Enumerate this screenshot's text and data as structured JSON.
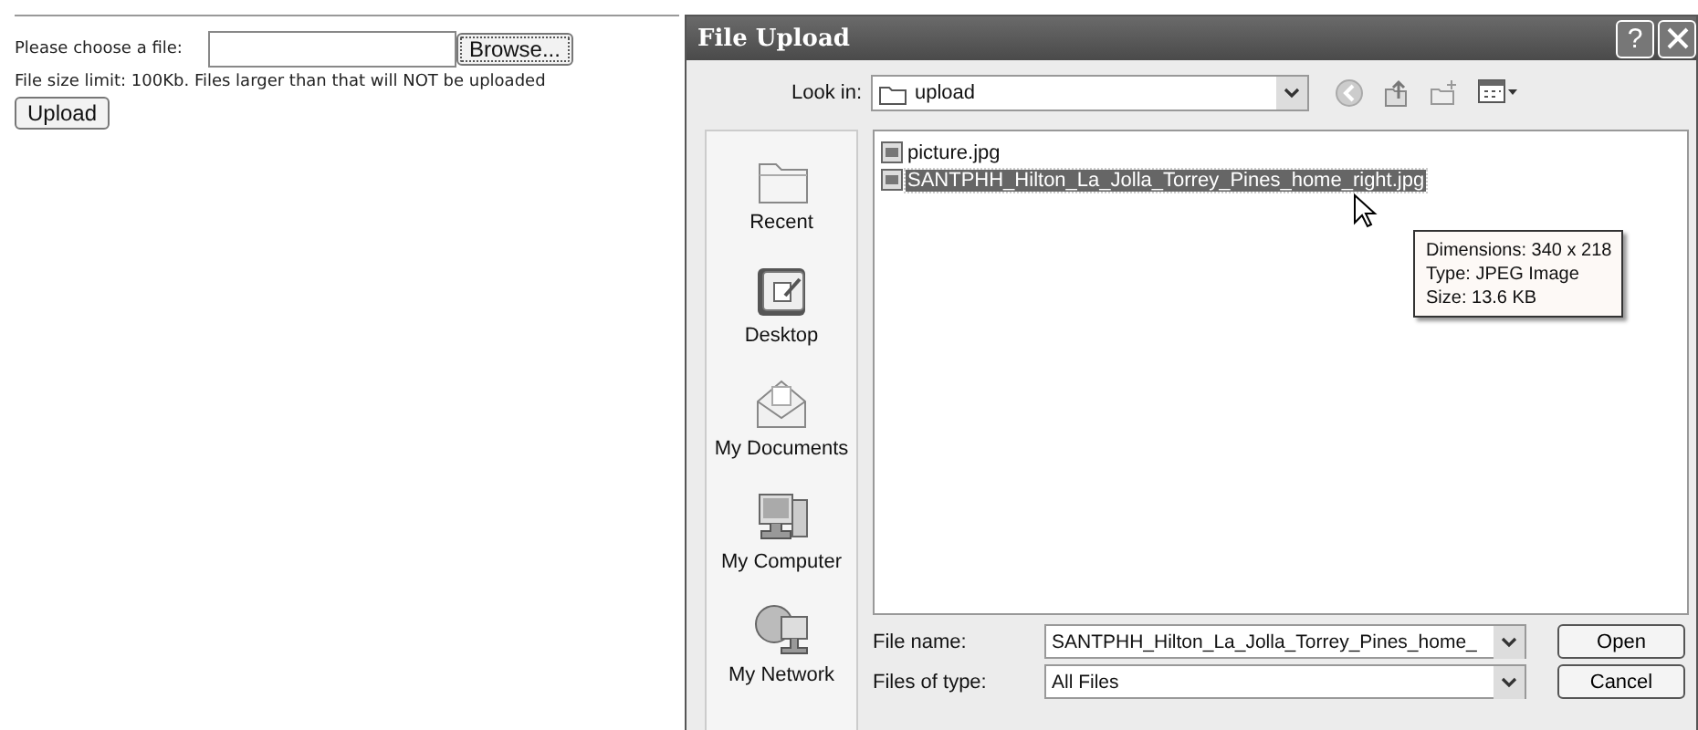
{
  "page": {
    "file_label": "Please choose a file:",
    "browse_button": "Browse...",
    "size_note": "File size limit: 100Kb. Files larger than that will NOT be uploaded",
    "upload_button": "Upload"
  },
  "dialog": {
    "title": "File Upload",
    "help_button": "?",
    "look_in": {
      "label": "Look in:",
      "value": "upload"
    },
    "places": [
      {
        "label": "Recent",
        "kind": "recent"
      },
      {
        "label": "Desktop",
        "kind": "desktop"
      },
      {
        "label": "My Documents",
        "kind": "documents"
      },
      {
        "label": "My Computer",
        "kind": "computer"
      },
      {
        "label": "My Network",
        "kind": "network"
      }
    ],
    "files": [
      {
        "name": "picture.jpg",
        "selected": false
      },
      {
        "name": "SANTPHH_Hilton_La_Jolla_Torrey_Pines_home_right.jpg",
        "selected": true
      }
    ],
    "tooltip": [
      "Dimensions: 340 x 218",
      "Type: JPEG Image",
      "Size: 13.6 KB"
    ],
    "file_name": {
      "label": "File name:",
      "value": "SANTPHH_Hilton_La_Jolla_Torrey_Pines_home_"
    },
    "file_type": {
      "label": "Files of type:",
      "value": "All Files"
    },
    "buttons": [
      "Open",
      "Cancel"
    ]
  }
}
